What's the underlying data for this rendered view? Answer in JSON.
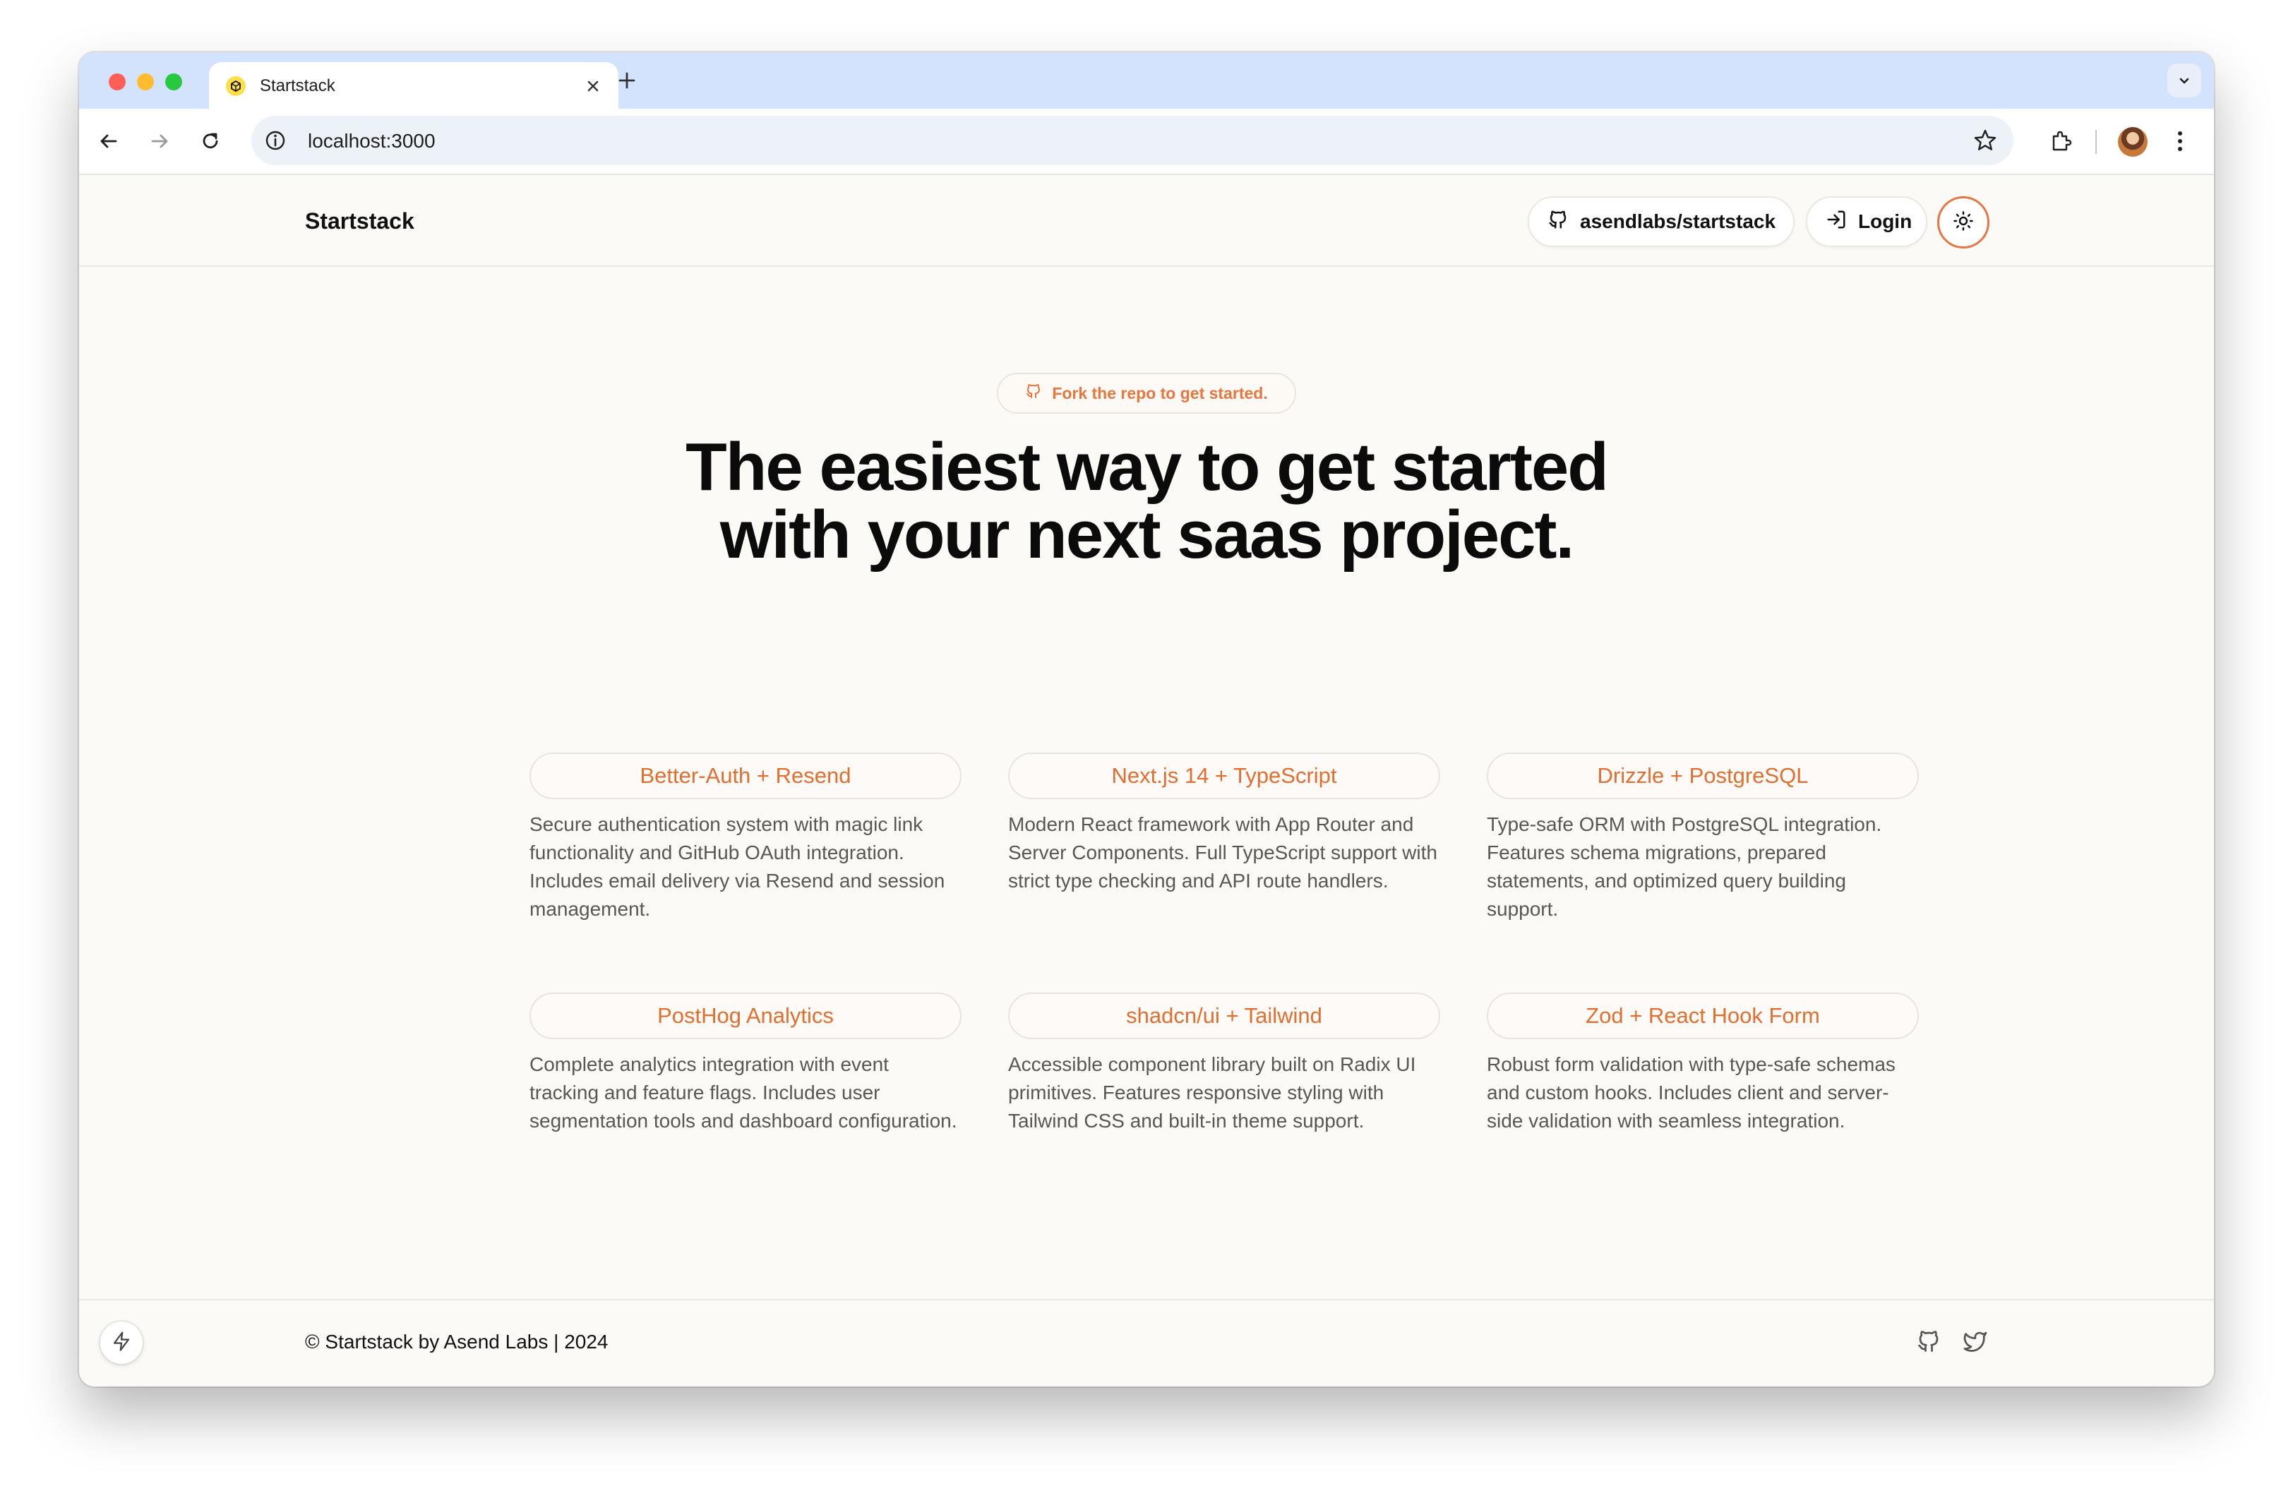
{
  "browser": {
    "tab_title": "Startstack",
    "url": "localhost:3000"
  },
  "header": {
    "brand": "Startstack",
    "repo_label": "asendlabs/startstack",
    "login_label": "Login"
  },
  "hero": {
    "pill": "Fork the repo to get started.",
    "title_line1": "The easiest way to get started",
    "title_line2": "with your next saas project."
  },
  "features": [
    {
      "title": "Better-Auth + Resend",
      "desc": "Secure authentication system with magic link functionality and GitHub OAuth integration. Includes email delivery via Resend and session management."
    },
    {
      "title": "Next.js 14 + TypeScript",
      "desc": "Modern React framework with App Router and Server Components. Full TypeScript support with strict type checking and API route handlers."
    },
    {
      "title": "Drizzle + PostgreSQL",
      "desc": "Type-safe ORM with PostgreSQL integration. Features schema migrations, prepared statements, and optimized query building support."
    },
    {
      "title": "PostHog Analytics",
      "desc": "Complete analytics integration with event tracking and feature flags. Includes user segmentation tools and dashboard configuration."
    },
    {
      "title": "shadcn/ui + Tailwind",
      "desc": "Accessible component library built on Radix UI primitives. Features responsive styling with Tailwind CSS and built-in theme support."
    },
    {
      "title": "Zod + React Hook Form",
      "desc": "Robust form validation with type-safe schemas and custom hooks. Includes client and server-side validation with seamless integration."
    }
  ],
  "footer": {
    "copyright": "© Startstack by Asend Labs | 2024"
  },
  "colors": {
    "accent": "#e8773f",
    "background": "#fcfaf7",
    "tabstrip": "#d3e3fd"
  },
  "icons": [
    "github-icon",
    "login-icon",
    "sun-icon",
    "twitter-icon",
    "bolt-icon"
  ]
}
